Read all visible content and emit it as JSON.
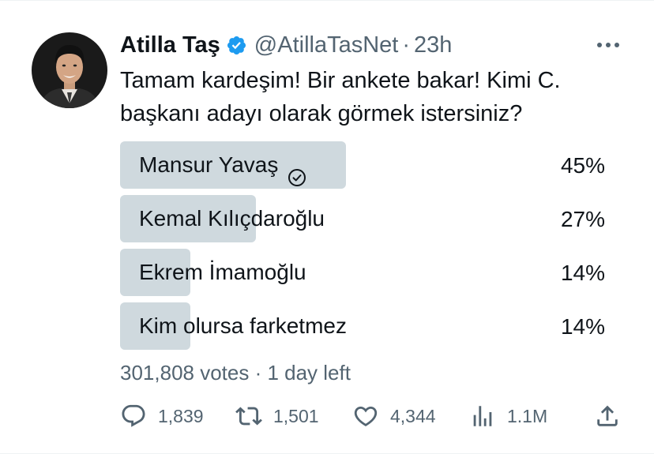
{
  "tweet": {
    "author": {
      "display_name": "Atilla Taş",
      "handle": "@AtillaTasNet",
      "separator": "·",
      "time": "23h",
      "verified": true,
      "verified_color": "#1d9bf0"
    },
    "text_line1": "Tamam kardeşim! Bir ankete bakar! Kimi C.",
    "text_line2": "başkanı adayı olarak görmek istersiniz?"
  },
  "poll": {
    "options": [
      {
        "label": "Mansur Yavaş",
        "percent_label": "45%",
        "percent": 45,
        "winner": true
      },
      {
        "label": "Kemal Kılıçdaroğlu",
        "percent_label": "27%",
        "percent": 27,
        "winner": false
      },
      {
        "label": "Ekrem İmamoğlu",
        "percent_label": "14%",
        "percent": 14,
        "winner": false
      },
      {
        "label": "Kim olursa farketmez",
        "percent_label": "14%",
        "percent": 14,
        "winner": false
      }
    ],
    "meta": "301,808 votes · 1 day left",
    "bar_color": "#cfd9de"
  },
  "actions": {
    "reply_count": "1,839",
    "retweet_count": "1,501",
    "like_count": "4,344",
    "views_count": "1.1M"
  },
  "icons": {
    "verified": "verified-badge-icon",
    "more": "more-options-icon",
    "reply": "reply-icon",
    "retweet": "retweet-icon",
    "like": "like-icon",
    "views": "views-icon",
    "share": "share-icon",
    "winner": "check-circle-icon"
  }
}
